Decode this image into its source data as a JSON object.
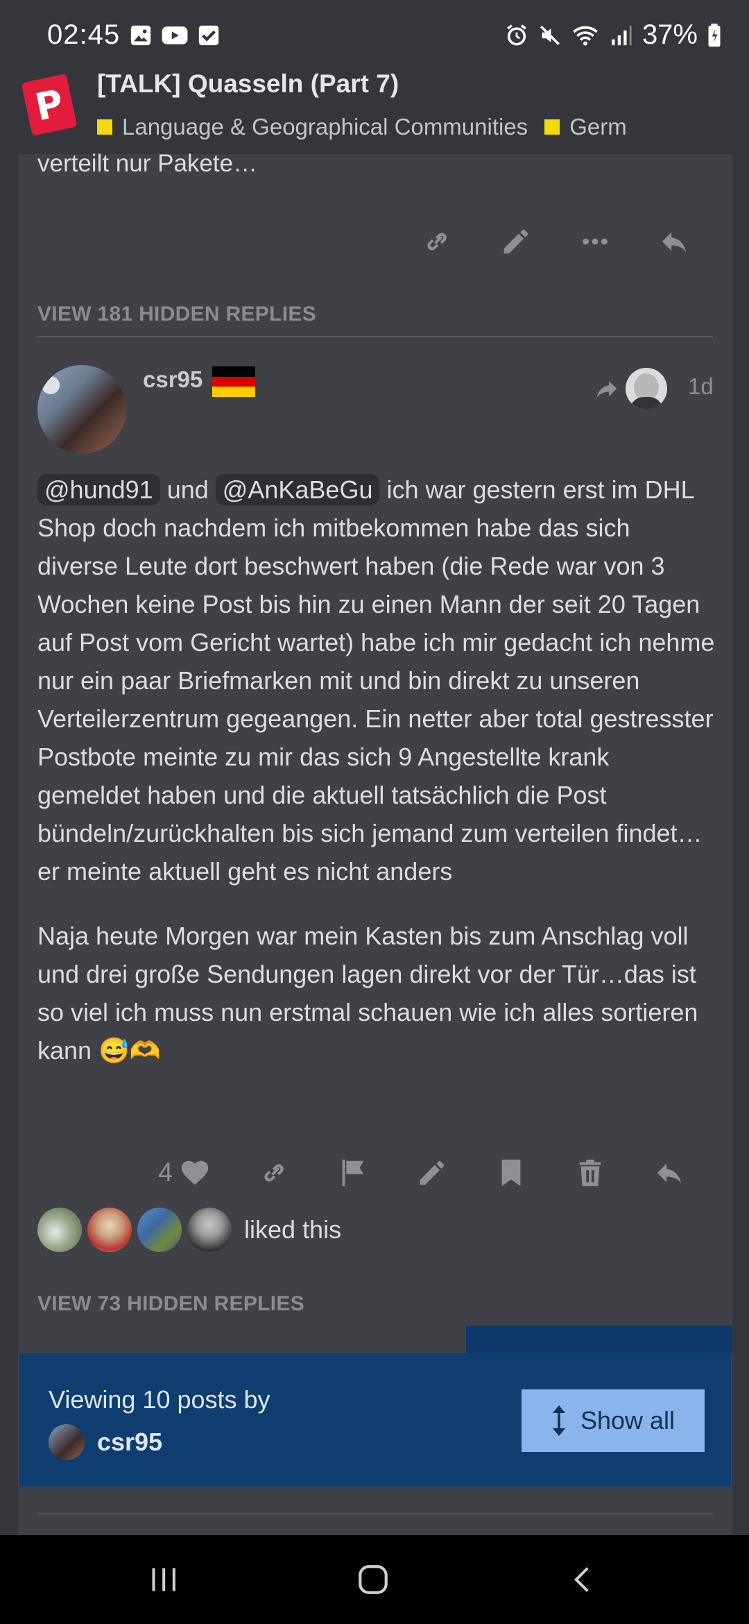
{
  "status_bar": {
    "time": "02:45",
    "battery": "37%",
    "left_icons": [
      "image-icon",
      "youtube-icon",
      "checkbox-icon"
    ],
    "right_icons": [
      "alarm-icon",
      "mute-icon",
      "wifi-icon",
      "signal-icon",
      "battery-icon"
    ]
  },
  "header": {
    "logo_letter": "P",
    "title": "[TALK] Quasseln (Part 7)",
    "categories": [
      {
        "label": "Language & Geographical Communities",
        "color": "#f5d90a"
      },
      {
        "label": "Germ",
        "color": "#f5d90a"
      }
    ]
  },
  "previous_post": {
    "truncated_text": "verteilt nur Pakete…"
  },
  "hidden_replies_top": "VIEW 181 HIDDEN REPLIES",
  "post": {
    "username": "csr95",
    "date": "1d",
    "mention1": "@hund91",
    "connector": "und",
    "mention2": "@AnKaBeGu",
    "paragraph1_rest": "ich war gestern erst im DHL Shop doch nachdem ich mitbekommen habe das sich diverse Leute dort beschwert haben (die Rede war von 3 Wochen keine Post bis hin zu einen Mann der seit 20 Tagen auf Post vom Gericht wartet) habe ich mir gedacht ich nehme nur ein paar Briefmarken mit und bin direkt zu unseren Verteilerzentrum gegeangen. Ein netter aber total gestresster Postbote meinte zu mir das sich 9 Angestellte krank gemeldet haben und die aktuell tatsächlich die Post bündeln/zurückhalten bis sich jemand zum verteilen findet…er meinte aktuell geht es nicht anders",
    "paragraph2": "Naja heute Morgen war mein Kasten bis zum Anschlag voll und drei große Sendungen lagen direkt vor der Tür…das ist so viel ich muss nun erstmal schauen wie ich alles sortieren kann 😅🫶",
    "like_count": "4",
    "liked_text": "liked this"
  },
  "hidden_replies_bottom": "VIEW 73 HIDDEN REPLIES",
  "filter_banner": {
    "text": "Viewing 10 posts by",
    "username": "csr95",
    "button_label": "Show all"
  },
  "colors": {
    "background": "#34363b",
    "card": "#404146",
    "banner": "#0e3d70",
    "button": "#88b5ec"
  }
}
